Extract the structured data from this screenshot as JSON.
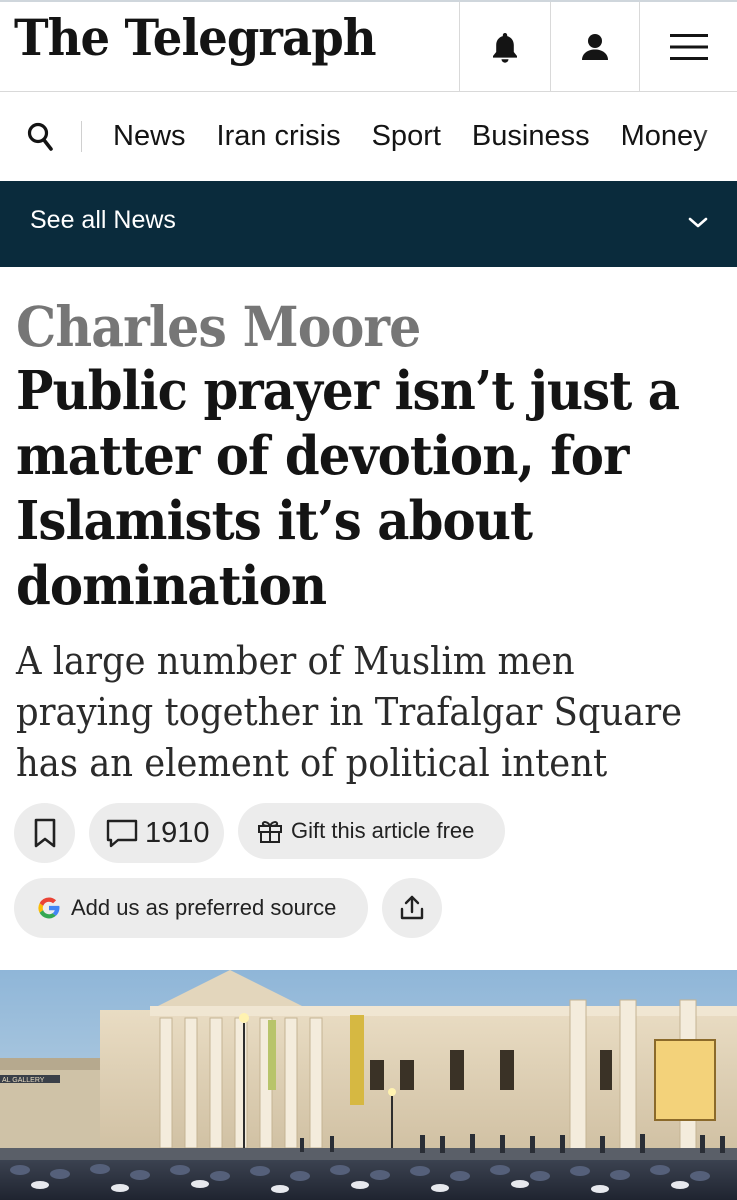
{
  "masthead": {
    "logo_text": "The Telegraph",
    "notifications_icon": "bell-icon",
    "account_icon": "user-icon",
    "menu_icon": "hamburger-menu-icon"
  },
  "nav": {
    "search_icon": "search-icon",
    "items": [
      "News",
      "Iran crisis",
      "Sport",
      "Business",
      "Money"
    ]
  },
  "section_bar": {
    "label": "See all News",
    "chevron_icon": "chevron-down-icon",
    "background": "#0a2b3c"
  },
  "article": {
    "author": "Charles Moore",
    "headline_lines": [
      "Public prayer isn’t just a",
      "matter of devotion, for",
      "Islamists it’s about",
      "domination"
    ],
    "standfirst_lines": [
      "A large number of Muslim men",
      "praying together in Trafalgar Square",
      "has an element of political intent"
    ]
  },
  "actions": {
    "bookmark_icon": "bookmark-icon",
    "comment_icon": "comment-icon",
    "comment_count": "1910",
    "gift_icon": "gift-icon",
    "gift_label": "Gift this article free",
    "google_icon": "google-g-icon",
    "preferred_source_label": "Add us as preferred source",
    "share_icon": "share-icon"
  },
  "image": {
    "gallery_banner_text": "National Gallery",
    "building_sign_text": "AL GALLERY"
  },
  "colors": {
    "text": "#141414",
    "author_grey": "#767676",
    "pill_bg": "#ececec",
    "section_bar": "#0a2b3c"
  }
}
